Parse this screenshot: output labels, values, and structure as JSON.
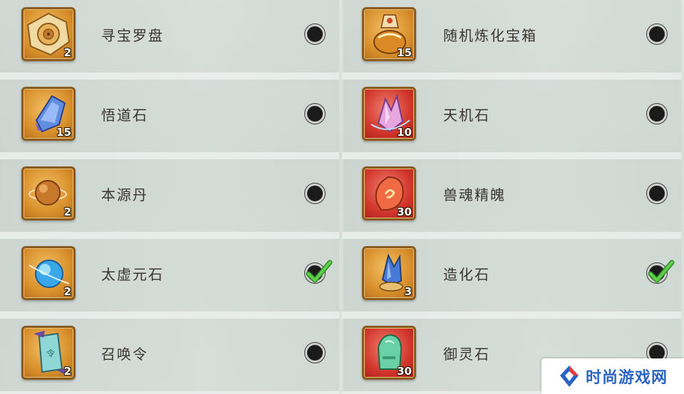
{
  "left_column": [
    {
      "name": "寻宝罗盘",
      "qty": "2",
      "frame": "gold",
      "icon": "compass-icon",
      "checked": false
    },
    {
      "name": "悟道石",
      "qty": "15",
      "frame": "gold",
      "icon": "blue-crystal-icon",
      "checked": false
    },
    {
      "name": "本源丹",
      "qty": "2",
      "frame": "gold",
      "icon": "orb-pill-icon",
      "checked": false
    },
    {
      "name": "太虚元石",
      "qty": "2",
      "frame": "gold",
      "icon": "blue-sphere-icon",
      "checked": true
    },
    {
      "name": "召唤令",
      "qty": "2",
      "frame": "gold",
      "icon": "summon-token-icon",
      "checked": false
    }
  ],
  "right_column": [
    {
      "name": "随机炼化宝箱",
      "qty": "15",
      "frame": "gold",
      "icon": "treasure-bag-icon",
      "checked": false
    },
    {
      "name": "天机石",
      "qty": "10",
      "frame": "red",
      "icon": "pink-crystal-icon",
      "checked": false
    },
    {
      "name": "兽魂精魄",
      "qty": "30",
      "frame": "red",
      "icon": "beast-soul-icon",
      "checked": false
    },
    {
      "name": "造化石",
      "qty": "3",
      "frame": "gold",
      "icon": "creation-crystal-icon",
      "checked": true
    },
    {
      "name": "御灵石",
      "qty": "30",
      "frame": "red",
      "icon": "jade-stone-icon",
      "checked": false
    }
  ],
  "watermark": {
    "brand": "时尚游戏网"
  }
}
